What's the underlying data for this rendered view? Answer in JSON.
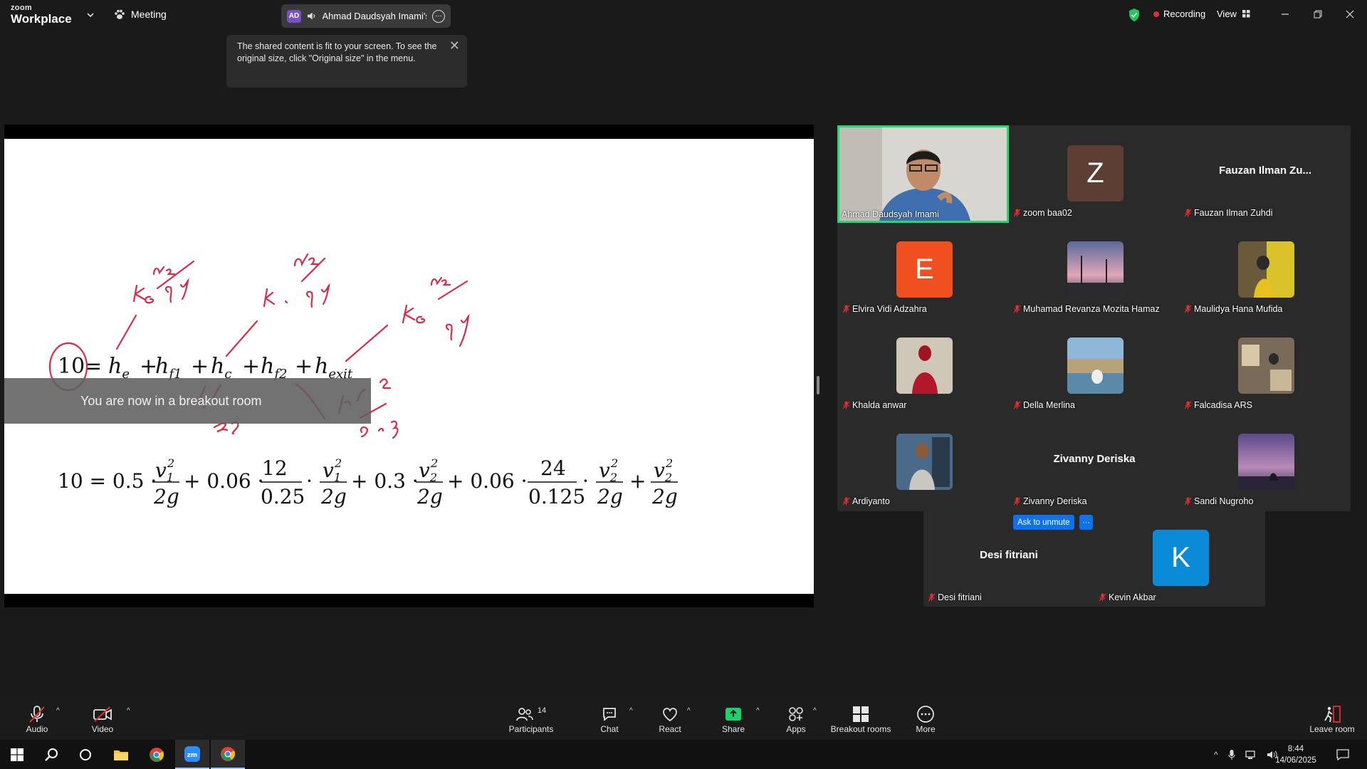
{
  "app": {
    "brand_small": "zoom",
    "brand_big": "Workplace",
    "meeting_label": "Meeting",
    "speaker_initials": "AD",
    "speaker_label": "Ahmad Daudsyah Imami's de",
    "recording_label": "Recording",
    "view_label": "View"
  },
  "tooltip": {
    "text": "The shared content is fit to your screen. To see the original size, click \"Original size\" in the menu."
  },
  "breakout": {
    "message": "You are now in a breakout room"
  },
  "gallery": {
    "tiles": [
      {
        "name": "Ahmad Daudsyah Imami",
        "kind": "video",
        "muted": false
      },
      {
        "name": "zoom baa02",
        "kind": "avatar",
        "letter": "Z",
        "color": "#5d3e33",
        "muted": true
      },
      {
        "name": "Fauzan Ilman Zuhdi",
        "kind": "text",
        "display": "Fauzan Ilman Zu...",
        "muted": true
      },
      {
        "name": "Elvira Vidi Adzahra",
        "kind": "avatar",
        "letter": "E",
        "color": "#f0501f",
        "muted": true
      },
      {
        "name": "Muhamad Revanza Mozita Hamaz",
        "kind": "photo",
        "muted": true
      },
      {
        "name": "Maulidya Hana Mufida",
        "kind": "photo",
        "muted": true
      },
      {
        "name": "Khalda anwar",
        "kind": "photo",
        "muted": true
      },
      {
        "name": "Della Merlina",
        "kind": "photo",
        "muted": true
      },
      {
        "name": "Falcadisa ARS",
        "kind": "photo",
        "muted": true
      },
      {
        "name": "Ardiyanto",
        "kind": "photo",
        "muted": true
      },
      {
        "name": "Zivanny Deriska",
        "kind": "text",
        "display": "Zivanny Deriska",
        "muted": true
      },
      {
        "name": "Sandi Nugroho",
        "kind": "photo",
        "muted": true
      },
      {
        "name": "Desi fitriani",
        "kind": "text",
        "display": "Desi fitriani",
        "muted": true
      },
      {
        "name": "Kevin Akbar",
        "kind": "avatar",
        "letter": "K",
        "color": "#0b8ad8",
        "muted": true
      }
    ],
    "ask_to_unmute": "Ask to unmute",
    "more_glyph": "···"
  },
  "toolbar": {
    "audio": "Audio",
    "video": "Video",
    "participants": "Participants",
    "participants_count": "14",
    "chat": "Chat",
    "react": "React",
    "share": "Share",
    "apps": "Apps",
    "breakout_rooms": "Breakout rooms",
    "more": "More",
    "leave_room": "Leave room"
  },
  "taskbar": {
    "time": "8:44",
    "date": "14/06/2025"
  },
  "colors": {
    "accent_green": "#23d96c",
    "accent_blue": "#0e72ed",
    "share_green": "#19d36c",
    "muted_red": "#e02f2f",
    "ink_red": "#d92b45"
  }
}
